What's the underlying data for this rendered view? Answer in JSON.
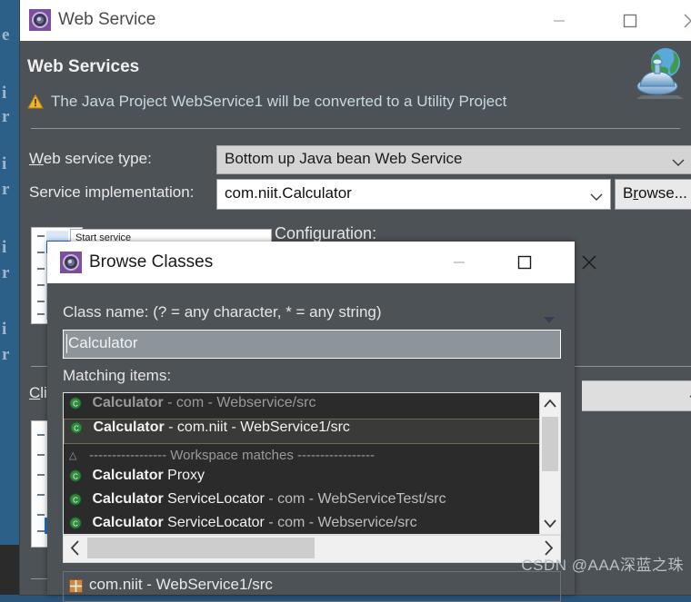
{
  "background_window": {
    "edge_letters": [
      "e",
      "i",
      "r",
      "i",
      "r",
      "i",
      "r",
      "i",
      "r"
    ],
    "edge_color": "#2d6089"
  },
  "web_service_dialog": {
    "titlebar": {
      "icon": "eclipse-gear-icon",
      "title": "Web Service",
      "minimize_label": "minimize-icon",
      "maximize_label": "maximize-icon",
      "close_label": "close-icon"
    },
    "header": {
      "title": "Web Services",
      "warning_icon": "warning-triangle-icon",
      "warning_text": "The Java Project WebService1 will be converted to a Utility Project",
      "banner_icon": "web-service-globe-icon"
    },
    "form": {
      "type_label": "Web service type:",
      "type_label_mnemonic": "W",
      "type_value": "Bottom up Java bean Web Service",
      "impl_label": "Service implementation:",
      "impl_value": "com.niit.Calculator",
      "browse_label": "Browse...",
      "browse_mnemonic": "r",
      "start_service_label": "Start service",
      "configuration_label": "Configuration:",
      "client_label": "Client type:",
      "client_label_short": "Clie",
      "client_value": ""
    }
  },
  "browse_classes_dialog": {
    "titlebar": {
      "icon": "eclipse-gear-icon",
      "title": "Browse Classes",
      "minimize_label": "minimize-icon",
      "maximize_label": "maximize-icon",
      "close_label": "close-icon"
    },
    "class_name_label": "Class name: (? = any character, * = any string)",
    "history_arrow": "chevron-down-icon",
    "class_name_value": "Calculator",
    "matching_items_label": "Matching items:",
    "matching_items": [
      {
        "icon": "java-class-icon",
        "name": "Calculator",
        "detail": " - com - Webservice/src",
        "state": "dim",
        "type": "item"
      },
      {
        "icon": "java-class-icon",
        "name": "Calculator",
        "detail": " - com.niit - WebService1/src",
        "state": "selected",
        "type": "item"
      },
      {
        "icon": "expand-collapse-icon",
        "name": "",
        "detail": "----------------- Workspace matches -----------------",
        "state": "separator",
        "type": "separator"
      },
      {
        "icon": "java-class-icon",
        "name": "Calculator",
        "detail": "Proxy",
        "state": "normal",
        "type": "item-suffix"
      },
      {
        "icon": "java-class-icon",
        "name": "Calculator",
        "detail": "ServiceLocator",
        "detail2": " - com - WebServiceTest/src",
        "state": "normal",
        "type": "item-suffix-pkg"
      },
      {
        "icon": "java-class-icon",
        "name": "Calculator",
        "detail": "ServiceLocator",
        "detail2": " - com - Webservice/src",
        "state": "normal",
        "type": "item-suffix-pkg"
      }
    ],
    "vscroll": {
      "up_icon": "chevron-up-icon",
      "down_icon": "chevron-down-icon"
    },
    "hscroll": {
      "left_icon": "chevron-left-icon",
      "right_icon": "chevron-right-icon"
    },
    "status": {
      "icon": "package-icon",
      "text": "com.niit - WebService1/src"
    }
  },
  "watermark": "CSDN @AAA深蓝之珠",
  "colors": {
    "dialog_bg": "#4d5256",
    "titlebar_bg": "#ffffff",
    "list_bg": "#2b2b2b",
    "selection_bg": "#3a3a38",
    "accent_blue": "#1c76d2",
    "link_text": "#c4d9e6",
    "background_blue": "#2d6089"
  }
}
